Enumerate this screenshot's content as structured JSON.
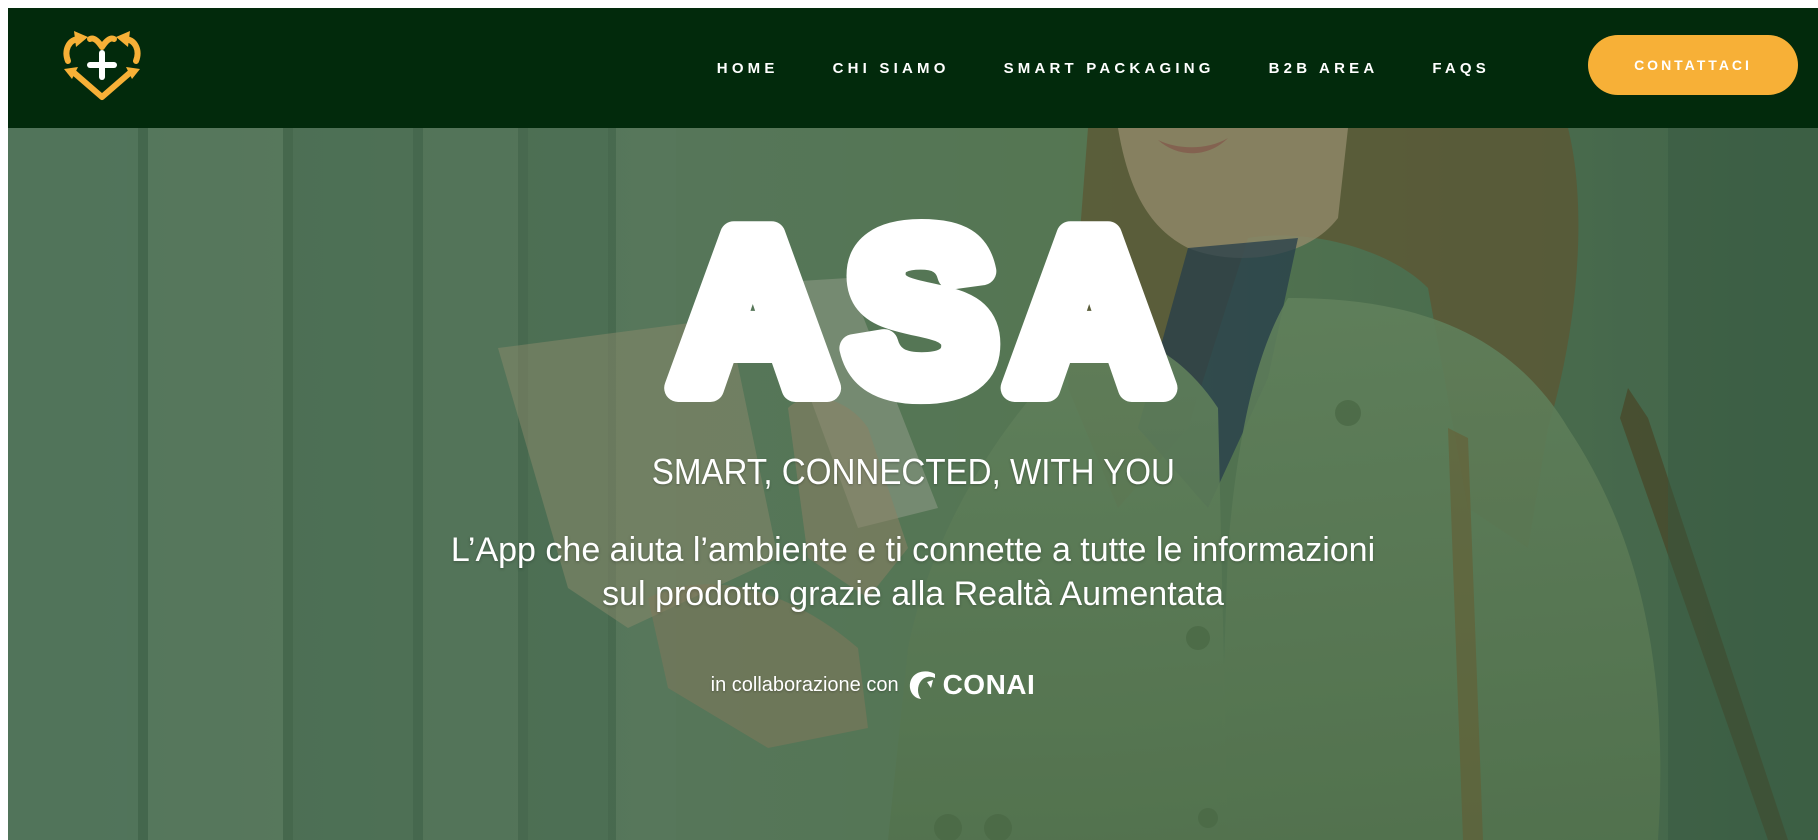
{
  "nav": {
    "items": [
      {
        "label": "HOME"
      },
      {
        "label": "CHI SIAMO"
      },
      {
        "label": "SMART PACKAGING"
      },
      {
        "label": "B2B AREA"
      },
      {
        "label": "FAQS"
      }
    ],
    "cta_label": "CONTATTACI"
  },
  "hero": {
    "title": "ASA",
    "tagline": "SMART, CONNECTED, WITH YOU",
    "description_line1": "L’App che aiuta l’ambiente e ti connette a tutte le informazioni",
    "description_line2": "sul prodotto grazie alla Realtà Aumentata",
    "collab_text": "in collaborazione con",
    "partner_name": "CONAI"
  },
  "colors": {
    "navbar": "#022a0c",
    "accent": "#f7b037",
    "hero_tint": "#64826a",
    "text": "#ffffff"
  },
  "icons": {
    "logo": "recycle-heart-plus-icon",
    "partner_logo": "conai-logo-icon"
  }
}
